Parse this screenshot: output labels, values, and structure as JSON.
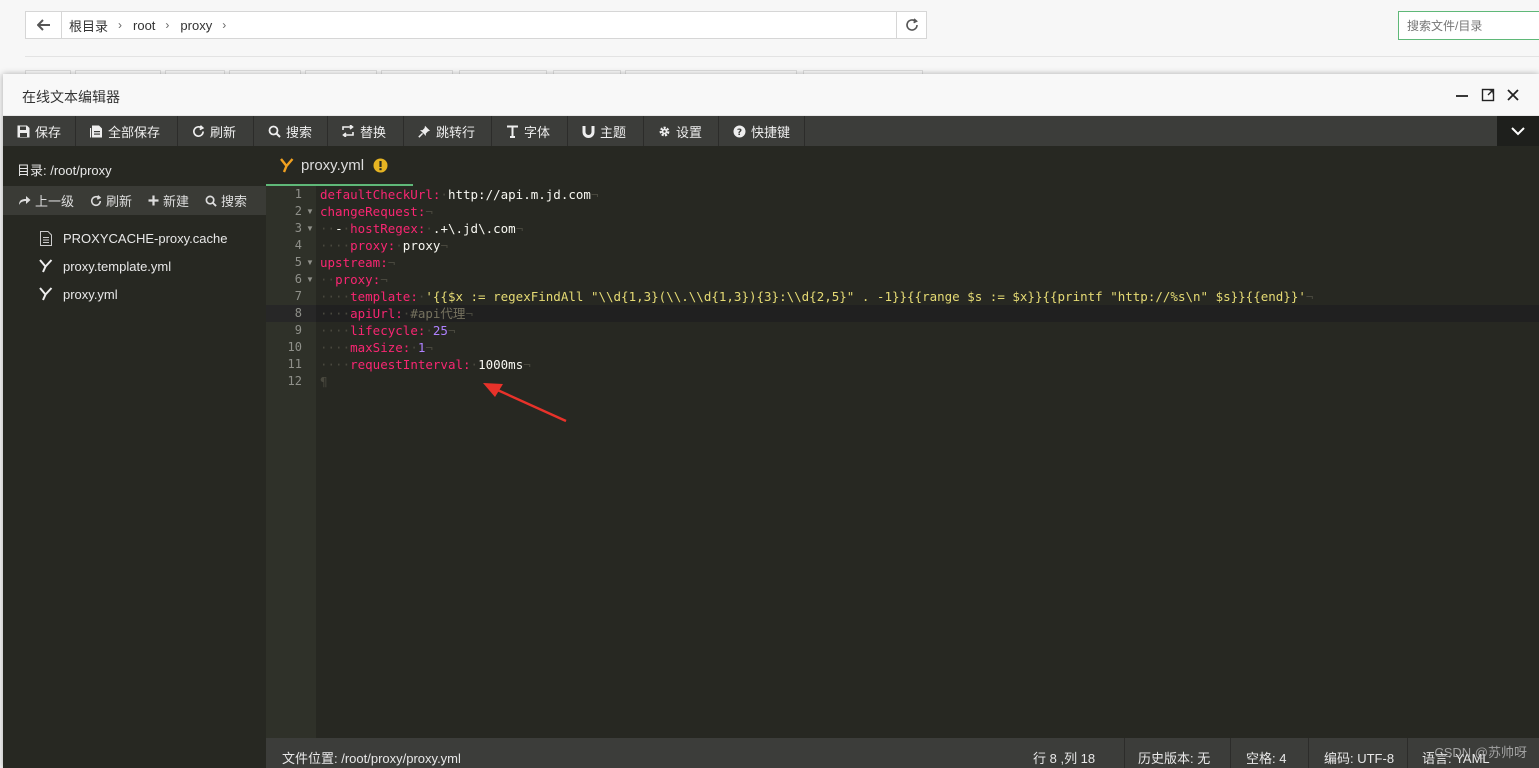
{
  "breadcrumb": {
    "items": [
      "根目录",
      "root",
      "proxy"
    ]
  },
  "top_search": {
    "placeholder": "搜索文件/目录"
  },
  "window": {
    "title": "在线文本编辑器"
  },
  "toolbar": {
    "buttons": [
      {
        "label": "保存",
        "icon": "save-icon"
      },
      {
        "label": "全部保存",
        "icon": "save-all-icon"
      },
      {
        "label": "刷新",
        "icon": "refresh-icon"
      },
      {
        "label": "搜索",
        "icon": "search-icon"
      },
      {
        "label": "替换",
        "icon": "replace-icon"
      },
      {
        "label": "跳转行",
        "icon": "pin-icon"
      },
      {
        "label": "字体",
        "icon": "font-icon"
      },
      {
        "label": "主题",
        "icon": "magnet-icon"
      },
      {
        "label": "设置",
        "icon": "gear-icon"
      },
      {
        "label": "快捷键",
        "icon": "question-icon"
      }
    ]
  },
  "sidebar": {
    "dir_label": "目录: /root/proxy",
    "actions": [
      {
        "label": "上一级",
        "icon": "share-icon"
      },
      {
        "label": "刷新",
        "icon": "refresh-icon"
      },
      {
        "label": "新建",
        "icon": "plus-icon"
      },
      {
        "label": "搜索",
        "icon": "search-icon"
      }
    ],
    "files": [
      {
        "name": "PROXYCACHE-proxy.cache",
        "icon": "file-icon"
      },
      {
        "name": "proxy.template.yml",
        "icon": "yaml-icon"
      },
      {
        "name": "proxy.yml",
        "icon": "yaml-icon"
      }
    ]
  },
  "editor": {
    "tab": {
      "name": "proxy.yml"
    },
    "lines": [
      {
        "n": "1"
      },
      {
        "n": "2"
      },
      {
        "n": "3"
      },
      {
        "n": "4"
      },
      {
        "n": "5"
      },
      {
        "n": "6"
      },
      {
        "n": "7"
      },
      {
        "n": "8"
      },
      {
        "n": "9"
      },
      {
        "n": "10"
      },
      {
        "n": "11"
      },
      {
        "n": "12"
      }
    ],
    "code": {
      "l1_key": "defaultCheckUrl:",
      "l1_val": "http://api.m.jd.com",
      "l2_key": "changeRequest:",
      "l3_key": "hostRegex:",
      "l3_val": ".+\\.jd\\.com",
      "l4_key": "proxy:",
      "l4_val": "proxy",
      "l5_key": "upstream:",
      "l6_key": "proxy:",
      "l7_key": "template:",
      "l7_val": "'{{$x := regexFindAll \"\\\\d{1,3}(\\\\.\\\\d{1,3}){3}:\\\\d{2,5}\" . -1}}{{range $s := $x}}{{printf \"http://%s\\n\" $s}}{{end}}'",
      "l8_key": "apiUrl:",
      "l8_comment": "#api代理",
      "l9_key": "lifecycle:",
      "l9_val": "25",
      "l10_key": "maxSize:",
      "l10_val": "1",
      "l11_key": "requestInterval:",
      "l11_val": "1000ms"
    }
  },
  "status": {
    "file_path": "文件位置: /root/proxy/proxy.yml",
    "cursor": "行 8 ,列 18",
    "history": "历史版本: 无",
    "indent": "空格: 4",
    "encoding": "编码: UTF-8",
    "language": "语言: YAML"
  },
  "watermark": "CSDN @苏帅呀",
  "colors": {
    "accent": "#5fb878",
    "editor_bg": "#272822",
    "key": "#f92672",
    "string": "#e6db74",
    "number": "#ae81ff",
    "comment": "#75715e",
    "annotation_arrow": "#e8322a"
  }
}
